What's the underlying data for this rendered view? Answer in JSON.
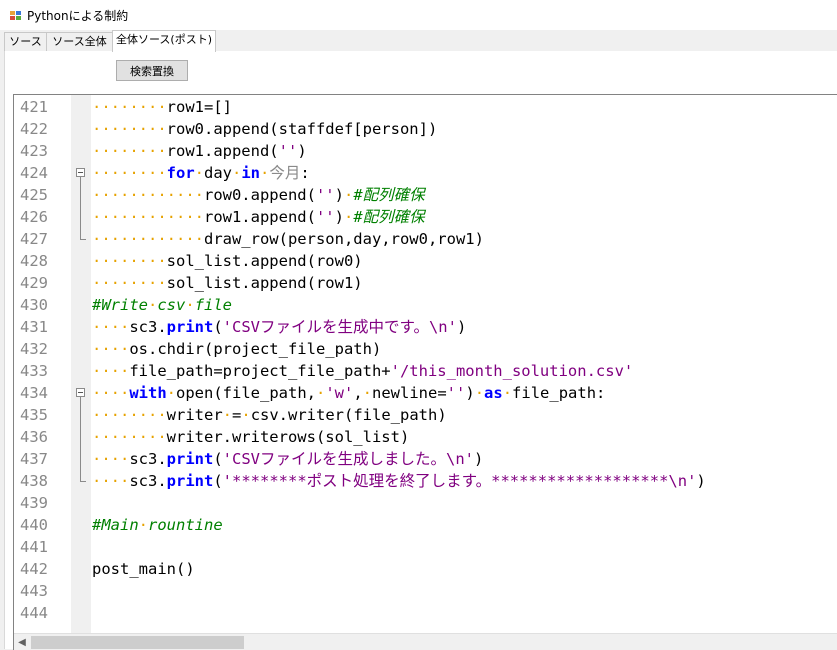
{
  "window": {
    "title": "Pythonによる制約",
    "icon": "app-window-icon",
    "icon_colors": [
      "#e8a23a",
      "#3a78d6",
      "#d84a3a",
      "#5aaa3a"
    ]
  },
  "tabs": [
    {
      "label": "ソース",
      "active": false
    },
    {
      "label": "ソース全体",
      "active": false
    },
    {
      "label": "全体ソース(ポスト)",
      "active": true
    }
  ],
  "toolbar": {
    "search_replace_label": "検索置換"
  },
  "colors": {
    "keyword": "#0000ff",
    "string": "#800080",
    "comment": "#008000",
    "whitespace_marker": "#e6a200",
    "line_number": "#888888"
  },
  "editor": {
    "lines": [
      {
        "num": "421",
        "segs": [
          [
            "ind",
            "········"
          ],
          [
            "t",
            "row1=[]"
          ]
        ]
      },
      {
        "num": "422",
        "segs": [
          [
            "ind",
            "········"
          ],
          [
            "t",
            "row0.append(staffdef[person])"
          ]
        ]
      },
      {
        "num": "423",
        "segs": [
          [
            "ind",
            "········"
          ],
          [
            "t",
            "row1.append("
          ],
          [
            "str",
            "''"
          ],
          [
            "t",
            ")"
          ]
        ]
      },
      {
        "num": "424",
        "segs": [
          [
            "ind",
            "········"
          ],
          [
            "kw",
            "for"
          ],
          [
            "dot",
            "·"
          ],
          [
            "t",
            "day"
          ],
          [
            "dot",
            "·"
          ],
          [
            "kw",
            "in"
          ],
          [
            "dot",
            "·"
          ],
          [
            "gray",
            "今月"
          ],
          [
            "t",
            ":"
          ]
        ]
      },
      {
        "num": "425",
        "segs": [
          [
            "ind",
            "············"
          ],
          [
            "t",
            "row0.append("
          ],
          [
            "str",
            "''"
          ],
          [
            "t",
            ")"
          ],
          [
            "dot",
            "·"
          ],
          [
            "cmt",
            "#配列確保"
          ]
        ]
      },
      {
        "num": "426",
        "segs": [
          [
            "ind",
            "············"
          ],
          [
            "t",
            "row1.append("
          ],
          [
            "str",
            "''"
          ],
          [
            "t",
            ")"
          ],
          [
            "dot",
            "·"
          ],
          [
            "cmt",
            "#配列確保"
          ]
        ]
      },
      {
        "num": "427",
        "segs": [
          [
            "ind",
            "············"
          ],
          [
            "t",
            "draw_row(person,day,row0,row1)"
          ]
        ]
      },
      {
        "num": "428",
        "segs": [
          [
            "ind",
            "········"
          ],
          [
            "t",
            "sol_list.append(row0)"
          ]
        ]
      },
      {
        "num": "429",
        "segs": [
          [
            "ind",
            "········"
          ],
          [
            "t",
            "sol_list.append(row1)"
          ]
        ]
      },
      {
        "num": "430",
        "segs": [
          [
            "cmt",
            "#Write"
          ],
          [
            "dot",
            "·"
          ],
          [
            "cmt",
            "csv"
          ],
          [
            "dot",
            "·"
          ],
          [
            "cmt",
            "file"
          ]
        ]
      },
      {
        "num": "431",
        "segs": [
          [
            "ind",
            "····"
          ],
          [
            "t",
            "sc3."
          ],
          [
            "kw",
            "print"
          ],
          [
            "t",
            "("
          ],
          [
            "str",
            "'CSVファイルを生成中です。\\n'"
          ],
          [
            "t",
            ")"
          ]
        ]
      },
      {
        "num": "432",
        "segs": [
          [
            "ind",
            "····"
          ],
          [
            "t",
            "os.chdir(project_file_path)"
          ]
        ]
      },
      {
        "num": "433",
        "segs": [
          [
            "ind",
            "····"
          ],
          [
            "t",
            "file_path=project_file_path+"
          ],
          [
            "str",
            "'/this_month_solution.csv'"
          ]
        ]
      },
      {
        "num": "434",
        "segs": [
          [
            "ind",
            "····"
          ],
          [
            "kw",
            "with"
          ],
          [
            "dot",
            "·"
          ],
          [
            "t",
            "open(file_path,"
          ],
          [
            "dot",
            "·"
          ],
          [
            "str",
            "'w'"
          ],
          [
            "t",
            ","
          ],
          [
            "dot",
            "·"
          ],
          [
            "t",
            "newline="
          ],
          [
            "str",
            "''"
          ],
          [
            "t",
            ")"
          ],
          [
            "dot",
            "·"
          ],
          [
            "kw",
            "as"
          ],
          [
            "dot",
            "·"
          ],
          [
            "t",
            "file_path:"
          ]
        ]
      },
      {
        "num": "435",
        "segs": [
          [
            "ind",
            "········"
          ],
          [
            "t",
            "writer"
          ],
          [
            "dot",
            "·"
          ],
          [
            "t",
            "="
          ],
          [
            "dot",
            "·"
          ],
          [
            "t",
            "csv.writer(file_path)"
          ]
        ]
      },
      {
        "num": "436",
        "segs": [
          [
            "ind",
            "········"
          ],
          [
            "t",
            "writer.writerows(sol_list)"
          ]
        ]
      },
      {
        "num": "437",
        "segs": [
          [
            "ind",
            "····"
          ],
          [
            "t",
            "sc3."
          ],
          [
            "kw",
            "print"
          ],
          [
            "t",
            "("
          ],
          [
            "str",
            "'CSVファイルを生成しました。\\n'"
          ],
          [
            "t",
            ")"
          ]
        ]
      },
      {
        "num": "438",
        "segs": [
          [
            "ind",
            "····"
          ],
          [
            "t",
            "sc3."
          ],
          [
            "kw",
            "print"
          ],
          [
            "t",
            "("
          ],
          [
            "str",
            "'********ポスト処理を終了します。*******************\\n'"
          ],
          [
            "t",
            ")"
          ]
        ]
      },
      {
        "num": "439",
        "segs": []
      },
      {
        "num": "440",
        "segs": [
          [
            "cmt",
            "#Main"
          ],
          [
            "dot",
            "·"
          ],
          [
            "cmt",
            "rountine"
          ]
        ]
      },
      {
        "num": "441",
        "segs": []
      },
      {
        "num": "442",
        "segs": [
          [
            "t",
            "post_main()"
          ]
        ]
      },
      {
        "num": "443",
        "segs": []
      },
      {
        "num": "444",
        "segs": []
      }
    ],
    "fold_markers": [
      {
        "line_index": 3,
        "end_index": 6
      },
      {
        "line_index": 13,
        "end_index": 17
      }
    ]
  },
  "scrollbar": {
    "left_arrow_icon": "scroll-left-arrow-icon",
    "left_arrow_glyph": "◀"
  }
}
